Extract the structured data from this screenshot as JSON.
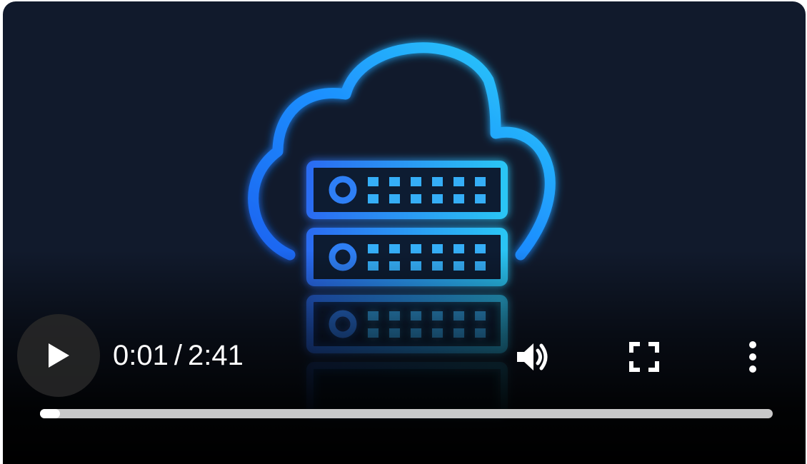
{
  "player": {
    "artwork_icon": "cloud-server-icon",
    "controls": {
      "play_icon": "play-icon",
      "current_time": "0:01",
      "time_separator": "/",
      "duration": "2:41",
      "volume_icon": "volume-icon",
      "fullscreen_icon": "fullscreen-icon",
      "more_icon": "more-options-icon"
    },
    "progress_fraction": 0.027,
    "colors": {
      "background": "#111a2c",
      "accent_blue": "#1e8fff",
      "accent_cyan": "#27c6f5",
      "progress_track": "#c9c9c9",
      "progress_played": "#ffffff"
    }
  }
}
